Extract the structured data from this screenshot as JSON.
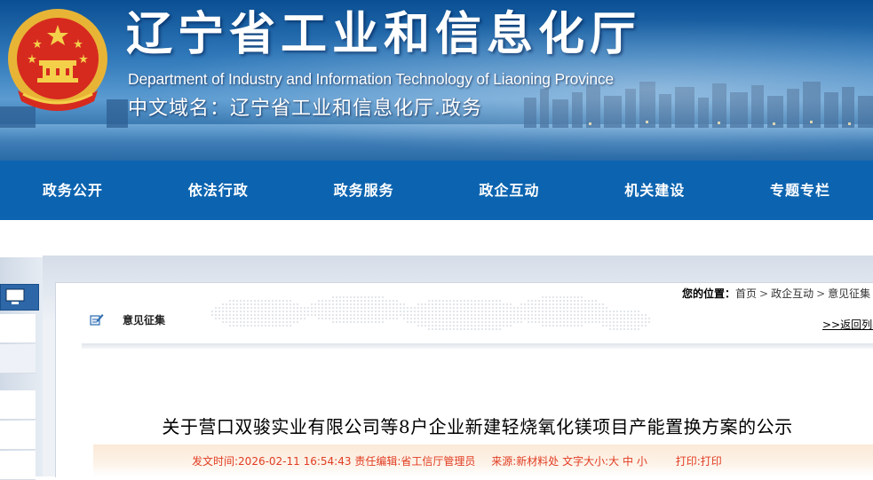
{
  "header": {
    "title": "辽宁省工业和信息化厅",
    "subtitle": "Department of Industry and Information Technology of Liaoning Province",
    "domain_line": "中文域名：辽宁省工业和信息化厅.政务"
  },
  "nav": {
    "items": [
      {
        "label": "政务公开"
      },
      {
        "label": "依法行政"
      },
      {
        "label": "政务服务"
      },
      {
        "label": "政企互动"
      },
      {
        "label": "机关建设"
      },
      {
        "label": "专题专栏"
      }
    ]
  },
  "breadcrumb": {
    "label": "您的位置：",
    "items": [
      "首页",
      "政企互动",
      "意见征集"
    ],
    "separator": ">"
  },
  "section": {
    "title": "意见征集",
    "back_link": ">>返回列表"
  },
  "article": {
    "title": "关于营口双骏实业有限公司等8户企业新建轻烧氧化镁项目产能置换方案的公示",
    "meta": {
      "date_label": "发文时间:",
      "date": "2026-02-11 16:54:43",
      "editor_label": "责任编辑:",
      "editor": "省工信厅管理员",
      "source_label": "来源:",
      "source": "新材料处",
      "font_size_label": "文字大小:",
      "font_sizes": [
        "大",
        "中",
        "小"
      ],
      "print_label": "打印:",
      "print_link": "打印"
    }
  },
  "colors": {
    "nav_bg": "#0c64b0",
    "meta_text": "#e13c22"
  },
  "icons": {
    "emblem": "national-emblem-icon",
    "section": "edit-note-icon"
  }
}
